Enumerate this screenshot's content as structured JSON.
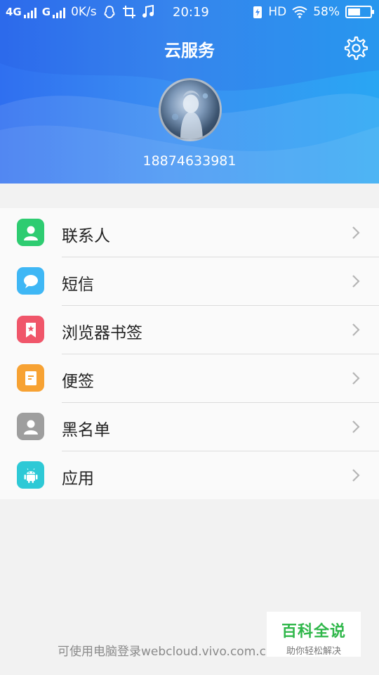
{
  "status_bar": {
    "net1": "4G",
    "net2": "G",
    "speed": "0K/s",
    "time": "20:19",
    "hd": "HD",
    "battery_text": "58%",
    "battery_level": 0.58
  },
  "header": {
    "title": "云服务",
    "phone": "18874633981",
    "settings_icon": "gear-icon"
  },
  "menu": {
    "items": [
      {
        "label": "联系人",
        "icon": "contact-icon",
        "color": "#2ecc71"
      },
      {
        "label": "短信",
        "icon": "message-icon",
        "color": "#3fb7f5"
      },
      {
        "label": "浏览器书签",
        "icon": "bookmark-icon",
        "color": "#f0566a"
      },
      {
        "label": "便签",
        "icon": "note-icon",
        "color": "#f7a233"
      },
      {
        "label": "黑名单",
        "icon": "blacklist-icon",
        "color": "#9e9e9e"
      },
      {
        "label": "应用",
        "icon": "android-icon",
        "color": "#2ec9d6"
      }
    ]
  },
  "footer": {
    "text": "可使用电脑登录webcloud.vivo.com.cn"
  },
  "watermark": {
    "title": "百科全说",
    "subtitle": "助你轻松解决"
  },
  "colors": {
    "header_start": "#2f6ff0",
    "header_end": "#29a6f3"
  }
}
